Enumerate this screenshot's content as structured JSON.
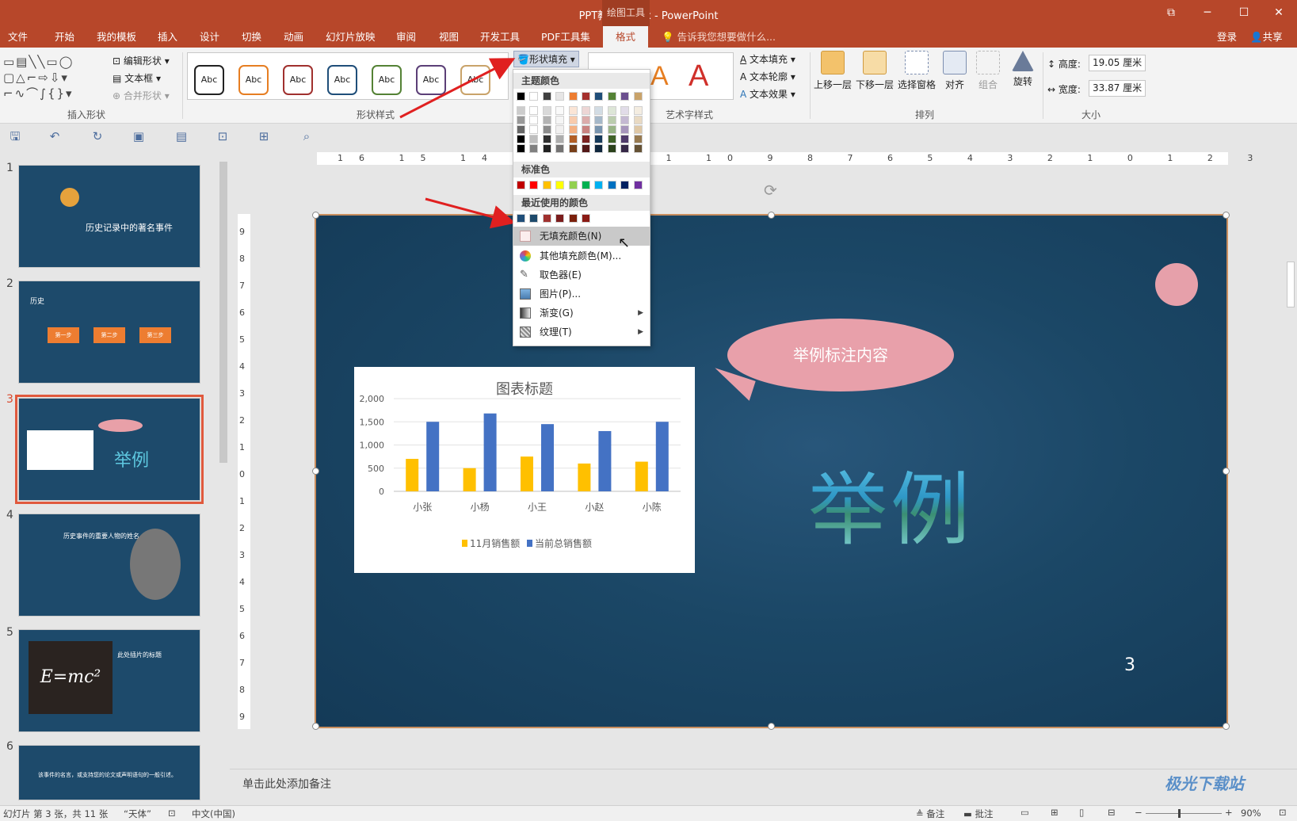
{
  "window": {
    "title": "PPT教程2.pptx - PowerPoint",
    "context_tab_group": "绘图工具",
    "controls": [
      "restore-down",
      "minimize",
      "maximize",
      "close"
    ]
  },
  "tabs": [
    {
      "label": "文件"
    },
    {
      "label": "开始"
    },
    {
      "label": "我的模板"
    },
    {
      "label": "插入"
    },
    {
      "label": "设计"
    },
    {
      "label": "切换"
    },
    {
      "label": "动画"
    },
    {
      "label": "幻灯片放映"
    },
    {
      "label": "审阅"
    },
    {
      "label": "视图"
    },
    {
      "label": "开发工具"
    },
    {
      "label": "PDF工具集"
    },
    {
      "label": "格式",
      "active": true
    }
  ],
  "tell_me": "告诉我您想要做什么...",
  "account": {
    "login": "登录",
    "share": "共享"
  },
  "ribbon": {
    "insert_shapes": {
      "label": "插入形状",
      "edit_shape": "编辑形状",
      "text_box": "文本框",
      "merge_shapes": "合并形状"
    },
    "shape_styles": {
      "label": "形状样式",
      "sample_text": "Abc",
      "fill_button": "形状填充",
      "style_colors": [
        "#222222",
        "#e67e22",
        "#a0302e",
        "#1f4e79",
        "#548235",
        "#5b3f77",
        "#c9a36a"
      ]
    },
    "wordart": {
      "label": "艺术字样式",
      "text_fill": "文本填充",
      "text_outline": "文本轮廓",
      "text_effects": "文本效果",
      "glyph": "A"
    },
    "arrange": {
      "label": "排列",
      "bring_forward": "上移一层",
      "send_backward": "下移一层",
      "selection_pane": "选择窗格",
      "align": "对齐",
      "group": "组合",
      "rotate": "旋转"
    },
    "size": {
      "label": "大小",
      "height_label": "高度:",
      "height_value": "19.05 厘米",
      "width_label": "宽度:",
      "width_value": "33.87 厘米"
    }
  },
  "ruler_h": "16 15 14 13 12 11 10 9 8 7 6 5 4 3 2 1 0 1 2 3 4 5 6 7 8 9 10 11 12 13 14 15 16",
  "ruler_v": "9 8 7 6 5 4 3 2 1 0 1 2 3 4 5 6 7 8 9",
  "fill_menu": {
    "theme_colors_label": "主题颜色",
    "theme_top": [
      "#000000",
      "#ffffff",
      "#404040",
      "#e7e6e6",
      "#ed7d31",
      "#a5302d",
      "#1f4e79",
      "#548235",
      "#6b4f8e",
      "#c9a36a"
    ],
    "standard_label": "标准色",
    "standard": [
      "#c00000",
      "#ff0000",
      "#ffc000",
      "#ffff00",
      "#92d050",
      "#00b050",
      "#00b0f0",
      "#0070c0",
      "#002060",
      "#7030a0"
    ],
    "recent_label": "最近使用的颜色",
    "recent": [
      "#1f4e79",
      "#1d4a6b",
      "#a0302e",
      "#7b1c1c",
      "#7a1f0b",
      "#8a1a14"
    ],
    "items": [
      {
        "label": "无填充颜色(N)",
        "icon": "no-fill-icon"
      },
      {
        "label": "其他填充颜色(M)...",
        "icon": "color-wheel-icon"
      },
      {
        "label": "取色器(E)",
        "icon": "eyedropper-icon"
      },
      {
        "label": "图片(P)...",
        "icon": "picture-icon"
      },
      {
        "label": "渐变(G)",
        "icon": "gradient-icon",
        "submenu": true
      },
      {
        "label": "纹理(T)",
        "icon": "texture-icon",
        "submenu": true
      }
    ]
  },
  "thumbnails": [
    {
      "num": "1",
      "title": "历史记录中的著名事件"
    },
    {
      "num": "2",
      "title": "历史",
      "steps": [
        "第一步",
        "第二步",
        "第三步"
      ]
    },
    {
      "num": "3",
      "title": "举例"
    },
    {
      "num": "4",
      "title": "历史事件的重要人物的姓名"
    },
    {
      "num": "5",
      "title": "此处插片的标题",
      "formula": "E=mc²"
    },
    {
      "num": "6",
      "title": "该事件的名言，或支持您的论文或声明语句的一般引述。"
    }
  ],
  "slide": {
    "callout": "举例标注内容",
    "big_text": "举例",
    "page_number": "3",
    "chart_data": {
      "type": "bar",
      "title": "图表标题",
      "categories": [
        "小张",
        "小杨",
        "小王",
        "小赵",
        "小陈"
      ],
      "series": [
        {
          "name": "11月销售额",
          "color": "#ffc000",
          "values": [
            700,
            500,
            750,
            600,
            640
          ]
        },
        {
          "name": "当前总销售额",
          "color": "#4472c4",
          "values": [
            1500,
            1680,
            1450,
            1300,
            1500
          ]
        }
      ],
      "ylim": [
        0,
        2000
      ],
      "yticks": [
        "0",
        "500",
        "1,000",
        "1,500",
        "2,000"
      ],
      "grid": true,
      "legend": "bottom"
    }
  },
  "notes_placeholder": "单击此处添加备注",
  "status": {
    "slide_info": "幻灯片 第 3 张，共 11 张",
    "theme": "“天体”",
    "language": "中文(中国)",
    "notes": "备注",
    "comments": "批注",
    "zoom": "90%"
  },
  "watermark": "极光下载站"
}
